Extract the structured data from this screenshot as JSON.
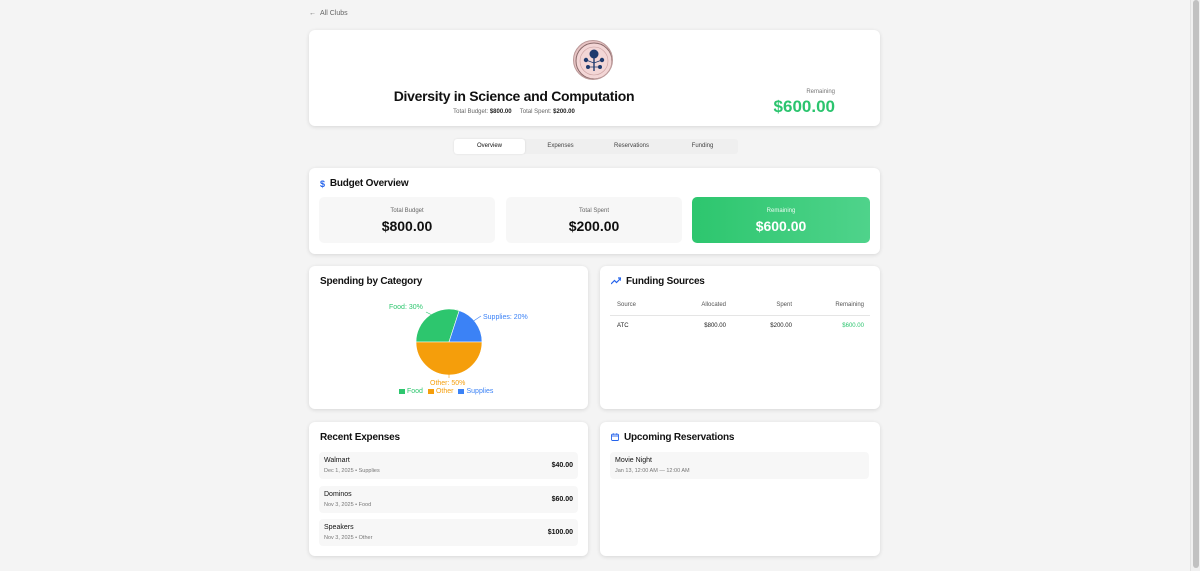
{
  "nav": {
    "back_label": "All Clubs"
  },
  "club": {
    "name": "Diversity in Science and Computation",
    "total_budget_label": "Total Budget:",
    "total_budget_value": "$800.00",
    "total_spent_label": "Total Spent:",
    "total_spent_value": "$200.00",
    "remaining_label": "Remaining",
    "remaining_value": "$600.00"
  },
  "tabs": [
    {
      "label": "Overview",
      "active": true
    },
    {
      "label": "Expenses"
    },
    {
      "label": "Reservations"
    },
    {
      "label": "Funding"
    }
  ],
  "budget_overview": {
    "title": "Budget Overview",
    "icon": "dollar-icon",
    "stats": [
      {
        "label": "Total Budget",
        "value": "$800.00"
      },
      {
        "label": "Total Spent",
        "value": "$200.00"
      },
      {
        "label": "Remaining",
        "value": "$600.00"
      }
    ]
  },
  "spending": {
    "title": "Spending by Category",
    "labels": {
      "food": "Food: 30%",
      "supplies": "Supplies: 20%",
      "other": "Other: 50%"
    },
    "legend": {
      "food": "Food",
      "other": "Other",
      "supplies": "Supplies"
    }
  },
  "chart_data": {
    "type": "pie",
    "categories": [
      "Food",
      "Supplies",
      "Other"
    ],
    "values": [
      30,
      20,
      50
    ],
    "colors": [
      "#2dc66e",
      "#3b82f6",
      "#f59e0b"
    ],
    "title": "Spending by Category",
    "legend": "bottom"
  },
  "funding": {
    "title": "Funding Sources",
    "icon": "trending-up-icon",
    "columns": [
      "Source",
      "Allocated",
      "Spent",
      "Remaining"
    ],
    "rows": [
      {
        "source": "ATC",
        "allocated": "$800.00",
        "spent": "$200.00",
        "remaining": "$600.00"
      }
    ]
  },
  "expenses": {
    "title": "Recent Expenses",
    "items": [
      {
        "name": "Walmart",
        "meta": "Dec 1, 2025 • Supplies",
        "amount": "$40.00"
      },
      {
        "name": "Dominos",
        "meta": "Nov 3, 2025 • Food",
        "amount": "$60.00"
      },
      {
        "name": "Speakers",
        "meta": "Nov 3, 2025 • Other",
        "amount": "$100.00"
      }
    ]
  },
  "reservations": {
    "title": "Upcoming Reservations",
    "icon": "calendar-icon",
    "items": [
      {
        "name": "Movie Night",
        "time": "Jan 13, 12:00 AM — 12:00 AM"
      }
    ]
  },
  "colors": {
    "green": "#2bc46e",
    "blue": "#2563eb",
    "orange": "#f59e0b"
  }
}
